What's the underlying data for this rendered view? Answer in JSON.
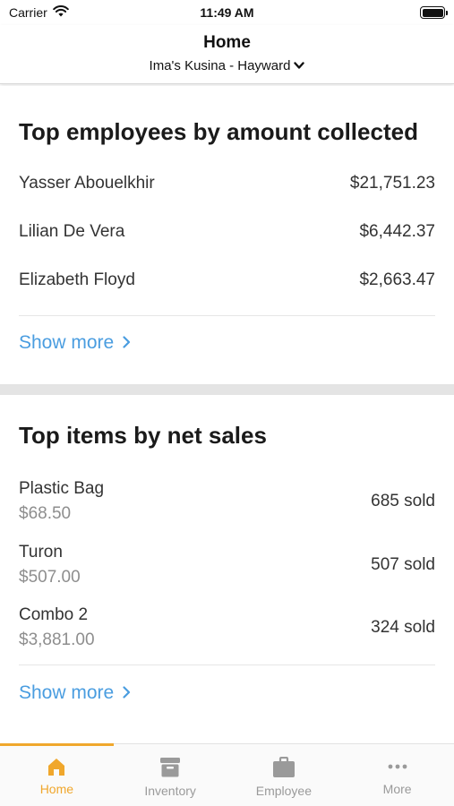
{
  "status_bar": {
    "carrier": "Carrier",
    "time": "11:49 AM"
  },
  "header": {
    "title": "Home",
    "location": "Ima's Kusina - Hayward"
  },
  "top_employees": {
    "title": "Top employees by amount collected",
    "rows": [
      {
        "name": "Yasser Abouelkhir",
        "amount": "$21,751.23"
      },
      {
        "name": "Lilian De Vera",
        "amount": "$6,442.37"
      },
      {
        "name": "Elizabeth Floyd",
        "amount": "$2,663.47"
      }
    ],
    "show_more": "Show more"
  },
  "top_items": {
    "title": "Top items by net sales",
    "rows": [
      {
        "name": "Plastic Bag",
        "price": "$68.50",
        "sold": "685 sold"
      },
      {
        "name": "Turon",
        "price": "$507.00",
        "sold": "507 sold"
      },
      {
        "name": "Combo 2",
        "price": "$3,881.00",
        "sold": "324 sold"
      }
    ],
    "show_more": "Show more"
  },
  "tab_bar": {
    "tabs": [
      {
        "label": "Home",
        "icon": "home-icon",
        "active": true
      },
      {
        "label": "Inventory",
        "icon": "inventory-box-icon",
        "active": false
      },
      {
        "label": "Employee",
        "icon": "briefcase-icon",
        "active": false
      },
      {
        "label": "More",
        "icon": "ellipsis-icon",
        "active": false
      }
    ]
  },
  "colors": {
    "accent": "#f0a72c",
    "link": "#4a9de0",
    "section_divider": "#e4e4e4",
    "inactive_tab": "#9a9a9a"
  }
}
